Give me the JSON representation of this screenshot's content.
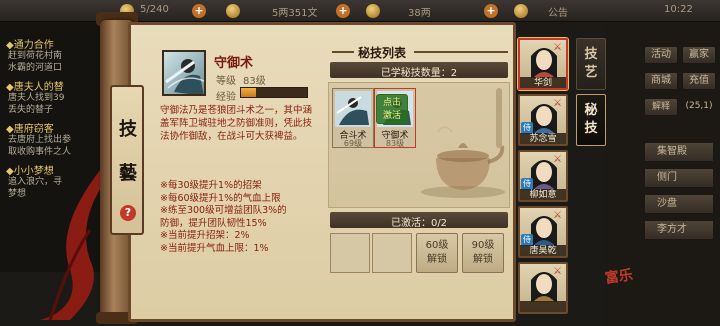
{
  "topbar": {
    "stamina": "5/240",
    "silver": "5两351文",
    "gold": "38两",
    "announcement": "公告",
    "time": "10:22"
  },
  "quests": [
    {
      "title": "◆通力合作",
      "lines": [
        "赶到荷花村南",
        "水霸的河道口"
      ]
    },
    {
      "title": "◆唐夫人的替",
      "lines": [
        "唐夫人找到39",
        "丢失的替子"
      ]
    },
    {
      "title": "◆唐府窃客",
      "lines": [
        "去唐府上找出参",
        "取收购事件之人"
      ]
    },
    {
      "title": "◆小小梦想",
      "lines": [
        "追入浪穴，寻",
        "梦想"
      ]
    }
  ],
  "side_tab": {
    "char1": "技",
    "char2": "藝",
    "help": "?"
  },
  "skill": {
    "name": "守御术",
    "level_label": "等级",
    "level_value": "83级",
    "exp_label": "经验",
    "exp_fraction": 0.22,
    "description": "守御法乃是苍狼团斗术之一，其中涵盖军阵卫城驻地之防御准则，凭此技法协作御敌，在战斗可大获裨益。",
    "effects": [
      "※每30级提升1%的招架",
      "※每60级提升1%的气血上限",
      "※练至300级可增益团队3%的",
      "  防御，提升团队韧性15%",
      "※当前提升招架：2%",
      "※当前提升气血上限：1%"
    ]
  },
  "list_panel": {
    "title": "秘技列表",
    "learned_count": "已学秘技数量：2",
    "cards": [
      {
        "name": "合斗术",
        "level": "69级"
      },
      {
        "name": "守御术",
        "level": "83级"
      }
    ],
    "click_badge": [
      "点击",
      "激活"
    ],
    "activated": "已激活：0/2",
    "locked_slots": [
      {
        "level": "60级",
        "text": "解锁"
      },
      {
        "level": "90级",
        "text": "解锁"
      }
    ]
  },
  "characters": [
    {
      "name": "华剑",
      "selected": true,
      "badge": "",
      "tint": "#b44a3c"
    },
    {
      "name": "苏念雪",
      "selected": false,
      "badge": "侍",
      "tint": "#3a6fa0"
    },
    {
      "name": "柳如意",
      "selected": false,
      "badge": "侍",
      "tint": "#6a5a8a"
    },
    {
      "name": "唐昊乾",
      "selected": false,
      "badge": "侍",
      "tint": "#2a5a8a"
    },
    {
      "name": "",
      "selected": false,
      "badge": "",
      "tint": "#a07a40"
    }
  ],
  "tabs": [
    {
      "label_top": "技",
      "label_bot": "艺",
      "active": false
    },
    {
      "label_top": "秘",
      "label_bot": "技",
      "active": true
    }
  ],
  "right_menu": {
    "buttons": [
      "活动",
      "赢家",
      "商城",
      "充值"
    ],
    "dismiss": "解释",
    "coords": "(25,1)",
    "list": [
      "集智殿",
      "侧门",
      "沙盘",
      "李方才"
    ]
  },
  "seal_text": "富乐",
  "colors": {
    "accent": "#c0392b",
    "parchment": "#e3d4b0",
    "wood": "#6b4a2c"
  }
}
